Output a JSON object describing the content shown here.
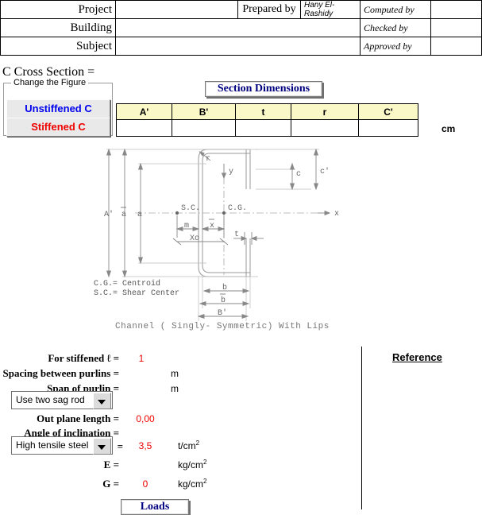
{
  "header": {
    "rows": [
      {
        "label": "Project",
        "value": "",
        "mid_label": "Prepared by",
        "mid_value": "Hany El-Rashidy",
        "right_label": "Computed by",
        "right_value": ""
      },
      {
        "label": "Building",
        "value": "",
        "mid_label": "",
        "mid_value": "",
        "right_label": "Checked by",
        "right_value": ""
      },
      {
        "label": "Subject",
        "value": "",
        "mid_label": "",
        "mid_value": "",
        "right_label": "Approved by",
        "right_value": ""
      }
    ]
  },
  "cross_section": {
    "title": "C Cross Section  =",
    "value": ""
  },
  "change_figure": {
    "caption": "Change the Figure",
    "unstiffened_label": "Unstiffened  C",
    "stiffened_label": "Stiffened C",
    "unstiffened_color": "#0000ee",
    "stiffened_color": "#ee0000"
  },
  "section_dimensions": {
    "title": "Section Dimensions",
    "title_color": "#000080",
    "header_bg": "#fbf8c8",
    "columns": [
      "A'",
      "B'",
      "t",
      "r",
      "C'"
    ],
    "values": [
      "",
      "",
      "",
      "",
      ""
    ],
    "unit": "cm"
  },
  "figure": {
    "caption": "Channel ( Singly- Symmetric) With Lips",
    "legend_cg": "C.G.= Centroid",
    "legend_sc": "S.C.= Shear Center",
    "labels": {
      "a_prime": "A'",
      "a_bar": "a",
      "a_low": "a",
      "b_prime": "B'",
      "b_bar": "b",
      "b_low": "b",
      "c_prime": "c'",
      "c_low": "c",
      "t": "t",
      "r": "r",
      "m": "m",
      "x_bar": "x",
      "x_o": "Xo",
      "axis_x": "x",
      "axis_y": "y",
      "sc": "S.C.",
      "cg": "C.G."
    }
  },
  "form": {
    "rows": [
      {
        "label": "For stiffened  ℓ    =",
        "value": "1",
        "unit": ""
      },
      {
        "label": "Spacing between purlins =",
        "value": "",
        "unit": "m"
      },
      {
        "label": "Span of purlin  =",
        "value": "",
        "unit": "m"
      },
      {
        "label": "Out plane length  =",
        "value": "0,00",
        "unit": ""
      },
      {
        "label": "Angle of inclination =",
        "value": "",
        "unit": ""
      }
    ],
    "sag_rod_select": {
      "value": "Use two sag rod"
    },
    "steel_select": {
      "value": "High tensile steel"
    },
    "steel_row": {
      "equals": "=",
      "value": "3,5",
      "unit_main": "t/cm",
      "unit_sup": "2"
    },
    "e_row": {
      "label": "E =",
      "value": "",
      "unit_main": "kg/cm",
      "unit_sup": "2"
    },
    "g_row": {
      "label": "G =",
      "value": "0",
      "unit_main": "kg/cm",
      "unit_sup": "2"
    },
    "value_color": "#ee0000"
  },
  "reference": {
    "label": "Reference"
  },
  "loads_button": {
    "label": "Loads",
    "color": "#000080"
  }
}
